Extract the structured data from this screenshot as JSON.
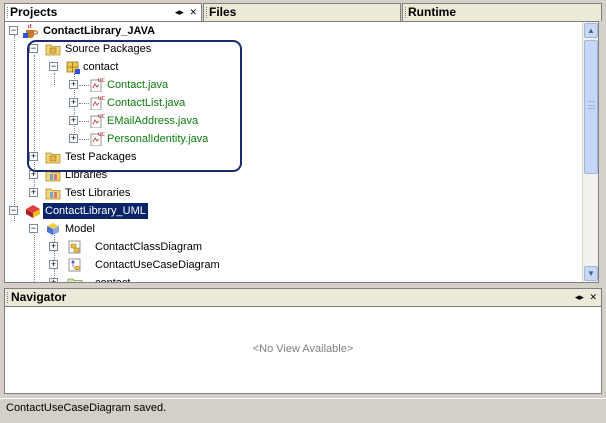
{
  "tabs": [
    {
      "label": "Projects",
      "active": true
    },
    {
      "label": "Files",
      "active": false
    },
    {
      "label": "Runtime",
      "active": false
    }
  ],
  "tab_controls": {
    "minimize": "◂▸",
    "close": "✕"
  },
  "tree": {
    "project_java": "ContactLibrary_JAVA",
    "source_packages": "Source Packages",
    "package_contact": "contact",
    "files": [
      "Contact.java",
      "ContactList.java",
      "EMailAddress.java",
      "PersonalIdentity.java"
    ],
    "test_packages": "Test Packages",
    "libraries": "Libraries",
    "test_libraries": "Test Libraries",
    "project_uml": "ContactLibrary_UML",
    "model": "Model",
    "class_diagram": "ContactClassDiagram",
    "usecase_diagram": "ContactUseCaseDiagram",
    "partial_item": "contact"
  },
  "navigator": {
    "title": "Navigator",
    "empty_message": "<No View Available>"
  },
  "status": {
    "message": "ContactUseCaseDiagram saved."
  },
  "colors": {
    "selection": "#0a246a",
    "java_file": "#0c7d0c",
    "highlight_border": "#1a2a6c"
  }
}
